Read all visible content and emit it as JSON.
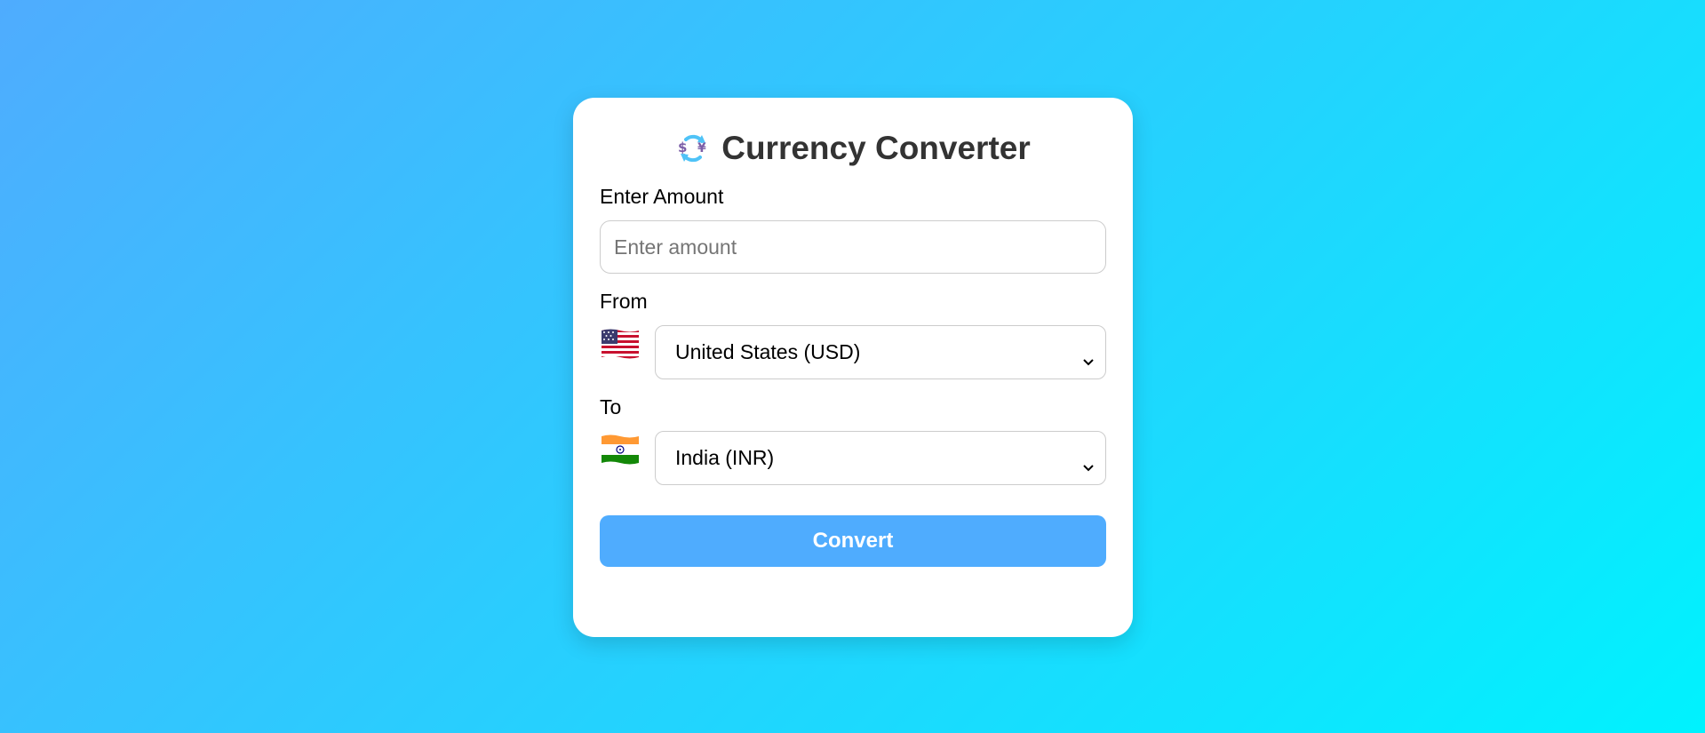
{
  "app": {
    "title": "Currency Converter",
    "title_icon": "currency-exchange-icon"
  },
  "amount": {
    "label": "Enter Amount",
    "value": "",
    "placeholder": "Enter amount"
  },
  "from": {
    "label": "From",
    "flag_icon": "us-flag-icon",
    "selected": "United States (USD)"
  },
  "to": {
    "label": "To",
    "flag_icon": "india-flag-icon",
    "selected": "India (INR)"
  },
  "actions": {
    "convert_label": "Convert"
  },
  "colors": {
    "gradient_start": "#4facfe",
    "gradient_end": "#00f2fe",
    "button": "#4facfe",
    "title_text": "#333333"
  }
}
